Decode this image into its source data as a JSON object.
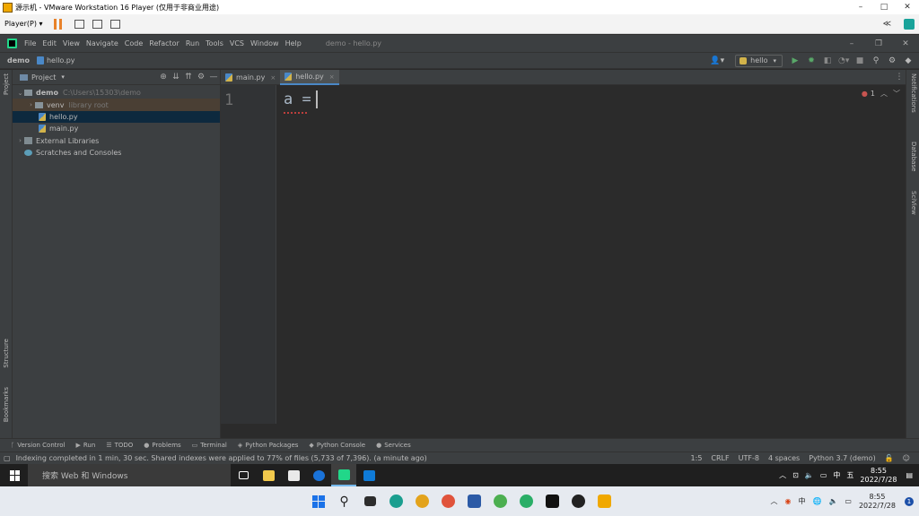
{
  "vmware": {
    "title": "源示机 - VMware Workstation 16 Player (仅用于非商业用途)",
    "player_menu": "Player(P)",
    "window_controls": [
      "–",
      "□",
      "✕"
    ]
  },
  "ide": {
    "menu": [
      "File",
      "Edit",
      "View",
      "Navigate",
      "Code",
      "Refactor",
      "Run",
      "Tools",
      "VCS",
      "Window",
      "Help"
    ],
    "window_title": "demo - hello.py",
    "breadcrumb_project": "demo",
    "breadcrumb_file": "hello.py",
    "run_config": "hello",
    "left_strip": {
      "project": "Project",
      "structure": "Structure",
      "bookmarks": "Bookmarks"
    },
    "right_strip": {
      "notifications": "Notifications",
      "database": "Database",
      "sciview": "SciView"
    },
    "project_panel": {
      "title": "Project",
      "tree": [
        {
          "label": "demo",
          "hint": "C:\\Users\\15303\\demo",
          "arrow": "⌄"
        },
        {
          "label": "venv",
          "hint": "library root",
          "arrow": "›"
        },
        {
          "label": "hello.py",
          "hint": "",
          "arrow": ""
        },
        {
          "label": "main.py",
          "hint": "",
          "arrow": ""
        },
        {
          "label": "External Libraries",
          "hint": "",
          "arrow": "›"
        },
        {
          "label": "Scratches and Consoles",
          "hint": "",
          "arrow": ""
        }
      ]
    },
    "tabs": [
      {
        "label": "main.py",
        "close": "×"
      },
      {
        "label": "hello.py",
        "close": "×"
      }
    ],
    "editor": {
      "line_number": "1",
      "code": "a =",
      "error_count": "1"
    },
    "tool_windows": [
      {
        "icon": "ᚴ",
        "label": "Version Control"
      },
      {
        "icon": "▶",
        "label": "Run"
      },
      {
        "icon": "☰",
        "label": "TODO"
      },
      {
        "icon": "●",
        "label": "Problems"
      },
      {
        "icon": "▭",
        "label": "Terminal"
      },
      {
        "icon": "◈",
        "label": "Python Packages"
      },
      {
        "icon": "◆",
        "label": "Python Console"
      },
      {
        "icon": "●",
        "label": "Services"
      }
    ],
    "status": {
      "message": "Indexing completed in 1 min, 30 sec. Shared indexes were applied to 77% of files (5,733 of 7,396). (a minute ago)",
      "position": "1:5",
      "line_sep": "CRLF",
      "encoding": "UTF-8",
      "indent": "4 spaces",
      "interpreter": "Python 3.7 (demo)"
    }
  },
  "guest_taskbar": {
    "search_placeholder": "搜索 Web 和 Windows",
    "time": "8:55",
    "date": "2022/7/28",
    "ime": "中",
    "ime2": "五"
  },
  "host_taskbar": {
    "time": "8:55",
    "date": "2022/7/28",
    "ime": "中",
    "notif_count": "1"
  }
}
